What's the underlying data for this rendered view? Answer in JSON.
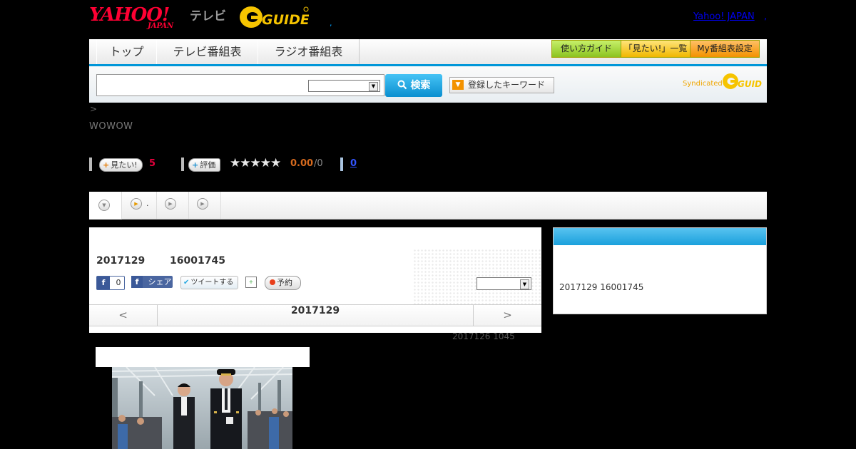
{
  "header": {
    "yahoo_logo_text": "YAHOO!",
    "yahoo_logo_sub": "JAPAN",
    "tv_label": "テレビ",
    "gguide_logo_text": "G GUIDE",
    "yahoo_japan_link": "Yahoo! JAPAN",
    "comma_link": ",",
    "small_dot": ","
  },
  "nav": {
    "tabs": [
      "トップ",
      "テレビ番組表",
      "ラジオ番組表"
    ],
    "guide_button": "使い方ガイド",
    "mitai_list_button": "「見たい!」一覧",
    "my_program_button": "My番組表設定"
  },
  "search": {
    "placeholder": "",
    "select_value": "",
    "button_label": "検索",
    "keyword_button": "登録したキーワード",
    "syndicated_label": "Syndicated"
  },
  "breadcrumb": ">",
  "channel": "WOWOW",
  "rating": {
    "mitai_label": "見たい!",
    "mitai_count": "5",
    "hyoka_label": "評価",
    "stars": "★★★★★",
    "score": "0.00",
    "score_total": "/0",
    "review_count": "0"
  },
  "tabs_strip": {
    "tab2_suffix": "."
  },
  "program": {
    "date": "2017129",
    "time": "16001745",
    "fb_like_count": "0",
    "fb_share_label": "シェア",
    "tweet_label": "ツイートする",
    "reserve_label": "予約",
    "select_value": "",
    "nav_prev": "<",
    "nav_date": "2017129",
    "nav_next": ">",
    "updated_note": "2017126  1045"
  },
  "sidebar": {
    "text": "2017129  16001745"
  },
  "colors": {
    "accent_blue": "#0096d8",
    "yahoo_red": "#ff0033",
    "gguide_yellow": "#f6c400"
  }
}
